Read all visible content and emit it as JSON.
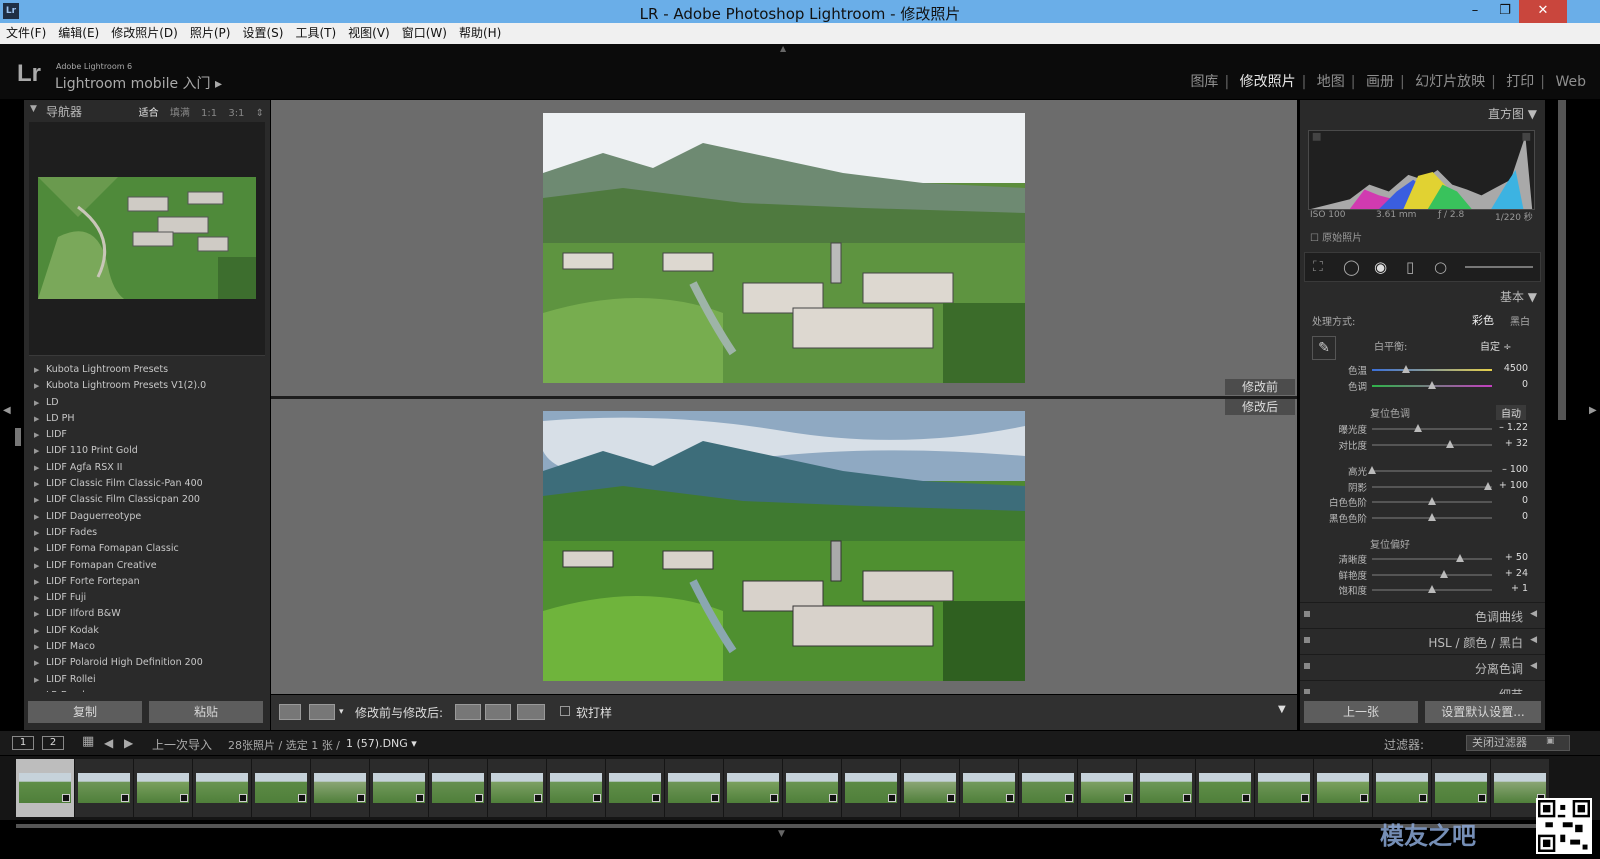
{
  "window": {
    "title": "LR - Adobe Photoshop Lightroom - 修改照片",
    "app_icon": "Lr",
    "controls": [
      "–",
      "❐",
      "✕"
    ]
  },
  "menu": [
    "文件(F)",
    "编辑(E)",
    "修改照片(D)",
    "照片(P)",
    "设置(S)",
    "工具(T)",
    "视图(V)",
    "窗口(W)",
    "帮助(H)"
  ],
  "identity": {
    "logo": "Lr",
    "product": "Adobe Lightroom 6",
    "mobile": "Lightroom mobile 入门 ▸"
  },
  "modules": [
    "图库",
    "修改照片",
    "地图",
    "画册",
    "幻灯片放映",
    "打印",
    "Web"
  ],
  "active_module": "修改照片",
  "navigator": {
    "title": "导航器",
    "zoom": [
      "适合",
      "填满",
      "1:1",
      "3:1"
    ]
  },
  "presets": [
    "Kubota Lightroom Presets",
    "Kubota Lightroom Presets V1(2).0",
    "LD",
    "LD PH",
    "LIDF",
    "LIDF 110 Print Gold",
    "LIDF Agfa RSX II",
    "LIDF Classic Film Classic-Pan 400",
    "LIDF Classic Film Classicpan 200",
    "LIDF Daguerreotype",
    "LIDF Fades",
    "LIDF Foma Fomapan Classic",
    "LIDF Fomapan Creative",
    "LIDF Forte Fortepan",
    "LIDF Fuji",
    "LIDF Ilford B&W",
    "LIDF Kodak",
    "LIDF Maco",
    "LIDF Polaroid High Definition 200",
    "LIDF Rollei",
    "LR Brush"
  ],
  "left_buttons": {
    "copy": "复制",
    "paste": "粘贴"
  },
  "center": {
    "before_label": "修改前",
    "after_label": "修改后"
  },
  "toolbar": {
    "mode_label": "修改前与修改后:",
    "softproof": "软打样"
  },
  "right": {
    "histogram_title": "直方图",
    "exif": {
      "iso": "ISO 100",
      "focal": "3.61 mm",
      "aperture": "ƒ / 2.8",
      "shutter": "1/220 秒"
    },
    "original_photo": "原始照片",
    "basic_title": "基本",
    "treatment_label": "处理方式:",
    "treatment_color": "彩色",
    "treatment_bw": "黑白",
    "wb_label": "白平衡:",
    "wb_value": "自定 ÷",
    "tone_label": "复位色调",
    "auto": "自动",
    "presence_label": "复位偏好",
    "sliders": [
      {
        "label": "色温",
        "value": "4500",
        "pos": 0.28
      },
      {
        "label": "色调",
        "value": "0",
        "pos": 0.5
      },
      {
        "label": "曝光度",
        "value": "– 1.22",
        "pos": 0.38
      },
      {
        "label": "对比度",
        "value": "+ 32",
        "pos": 0.65
      },
      {
        "label": "高光",
        "value": "– 100",
        "pos": 0.0
      },
      {
        "label": "阴影",
        "value": "+ 100",
        "pos": 0.97
      },
      {
        "label": "白色色阶",
        "value": "0",
        "pos": 0.5
      },
      {
        "label": "黑色色阶",
        "value": "0",
        "pos": 0.5
      },
      {
        "label": "清晰度",
        "value": "+ 50",
        "pos": 0.73
      },
      {
        "label": "鲜艳度",
        "value": "+ 24",
        "pos": 0.6
      },
      {
        "label": "饱和度",
        "value": "+ 1",
        "pos": 0.5
      }
    ],
    "tone_curve": "色调曲线",
    "hsl": "HSL / 颜色 / 黑白",
    "split": "分离色调",
    "detail": "细节",
    "prev": "上一张",
    "set_default": "设置默认设置..."
  },
  "filmbar": {
    "page1": "1",
    "page2": "2",
    "source": "上一次导入",
    "count": "28张照片 / 选定 1 张 / ",
    "file": "1 (57).DNG ▾",
    "filter_label": "过滤器:",
    "filter_value": "关闭过滤器"
  },
  "watermark": "模友之吧"
}
